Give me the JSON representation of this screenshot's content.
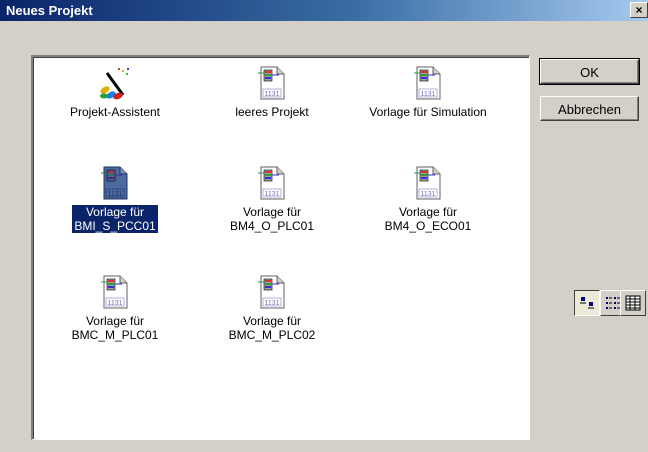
{
  "window": {
    "title": "Neues Projekt",
    "close_label": "×"
  },
  "buttons": {
    "ok": "OK",
    "cancel": "Abbrechen"
  },
  "items": [
    {
      "label": "Projekt-Assistent",
      "icon": "wizard-icon",
      "selected": false
    },
    {
      "label": "leeres Projekt",
      "icon": "template-file-icon",
      "selected": false
    },
    {
      "label": "Vorlage für Simulation",
      "icon": "template-file-icon",
      "selected": false
    },
    {
      "label_line1": "Vorlage für",
      "label_line2": "BMI_S_PCC01",
      "icon": "template-file-icon",
      "selected": true
    },
    {
      "label_line1": "Vorlage für",
      "label_line2": "BM4_O_PLC01",
      "icon": "template-file-icon",
      "selected": false
    },
    {
      "label_line1": "Vorlage für",
      "label_line2": "BM4_O_ECO01",
      "icon": "template-file-icon",
      "selected": false
    },
    {
      "label_line1": "Vorlage für",
      "label_line2": "BMC_M_PLC01",
      "icon": "template-file-icon",
      "selected": false
    },
    {
      "label_line1": "Vorlage für",
      "label_line2": "BMC_M_PLC02",
      "icon": "template-file-icon",
      "selected": false
    }
  ],
  "file_icon_text": "1131",
  "view_buttons": [
    {
      "name": "large-icons-view",
      "active": true
    },
    {
      "name": "list-view",
      "active": false
    },
    {
      "name": "details-view",
      "active": false
    }
  ],
  "colors": {
    "selection": "#0a246a",
    "face": "#d4d0c8"
  }
}
